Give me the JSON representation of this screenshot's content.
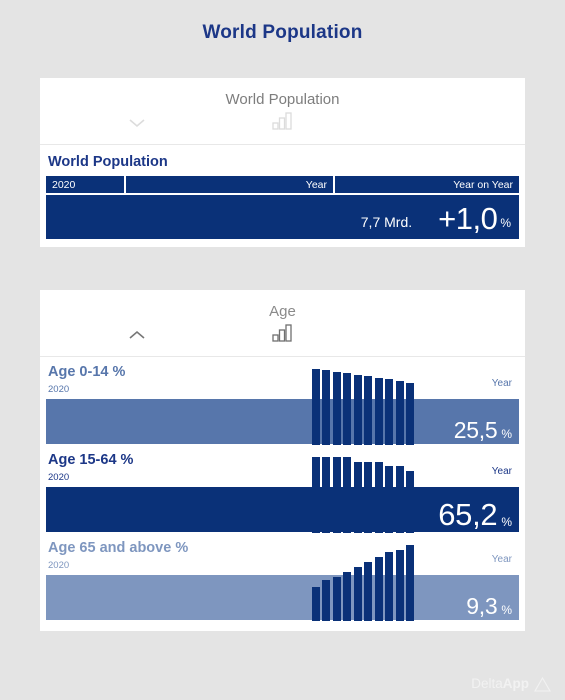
{
  "page": {
    "title": "World Population",
    "background_color": "#e4e4e4",
    "accent_color": "#1c3787",
    "bar_dark_color": "#0a3178",
    "bar_mid_color": "#5776ab",
    "bar_light_color": "#7e96bf"
  },
  "cards": [
    {
      "id": "world-population",
      "header_title": "World Population",
      "collapsed": true,
      "chevron_icon": "chevron-down-icon",
      "chart_icon": "bar-chart-icon",
      "kpi": {
        "label": "World Population",
        "year": "2020",
        "col_year": "Year",
        "col_year_on_year": "Year on Year",
        "value": "7,7 Mrd.",
        "change_value": "+1,0",
        "change_unit": "%"
      }
    },
    {
      "id": "age",
      "header_title": "Age",
      "collapsed": false,
      "chevron_icon": "chevron-up-icon",
      "chart_icon": "bar-chart-icon",
      "rows": [
        {
          "label": "Age 0-14 %",
          "year": "2020",
          "col_year": "Year",
          "value": "25,5",
          "unit": "%",
          "fill_color": "#5776ab",
          "label_color": "#5776ab",
          "value_size": "normal"
        },
        {
          "label": "Age 15-64 %",
          "year": "2020",
          "col_year": "Year",
          "value": "65,2",
          "unit": "%",
          "fill_color": "#0a3178",
          "label_color": "#1c3787",
          "value_size": "big"
        },
        {
          "label": "Age 65 and above %",
          "year": "2020",
          "col_year": "Year",
          "value": "9,3",
          "unit": "%",
          "fill_color": "#7e96bf",
          "label_color": "#7e96bf",
          "value_size": "normal"
        }
      ]
    }
  ],
  "chart_data": [
    {
      "type": "bar",
      "title": "Age 0-14 % sparkline",
      "categories": [
        "1",
        "2",
        "3",
        "4",
        "5",
        "6",
        "7",
        "8",
        "9",
        "10"
      ],
      "values": [
        27.4,
        27.2,
        27.0,
        26.8,
        26.6,
        26.4,
        26.2,
        26.0,
        25.8,
        25.5
      ],
      "ylabel": "%",
      "xlabel": "",
      "grid": false,
      "legend": "none"
    },
    {
      "type": "bar",
      "title": "Age 15-64 % sparkline",
      "categories": [
        "1",
        "2",
        "3",
        "4",
        "5",
        "6",
        "7",
        "8",
        "9",
        "10"
      ],
      "values": [
        65.5,
        65.5,
        65.5,
        65.5,
        65.4,
        65.4,
        65.4,
        65.3,
        65.3,
        65.2
      ],
      "ylabel": "%",
      "xlabel": "",
      "grid": false,
      "legend": "none"
    },
    {
      "type": "bar",
      "title": "Age 65 and above % sparkline",
      "categories": [
        "1",
        "2",
        "3",
        "4",
        "5",
        "6",
        "7",
        "8",
        "9",
        "10"
      ],
      "values": [
        7.6,
        7.9,
        8.0,
        8.2,
        8.4,
        8.6,
        8.8,
        9.0,
        9.1,
        9.3
      ],
      "ylabel": "%",
      "xlabel": "",
      "grid": false,
      "legend": "none"
    }
  ],
  "footer": {
    "brand_light": "Delta",
    "brand_bold": "App",
    "logo_icon": "triangle-logo-icon"
  }
}
